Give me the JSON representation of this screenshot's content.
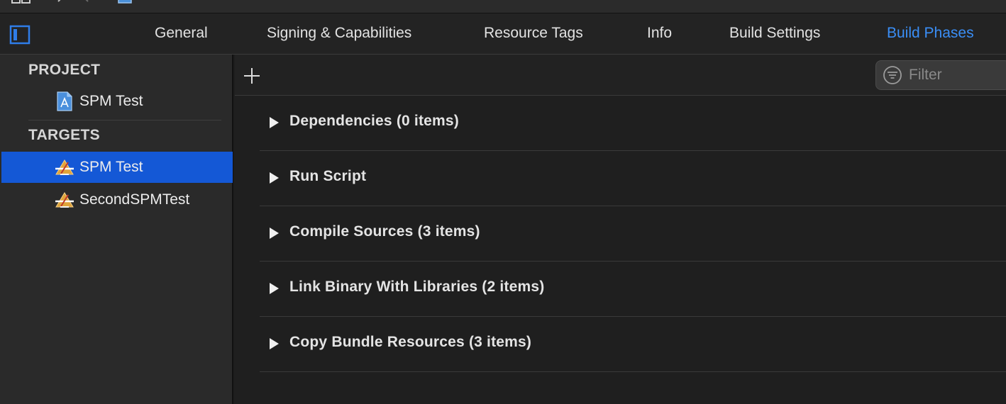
{
  "tabs": [
    {
      "label": "General",
      "active": false
    },
    {
      "label": "Signing & Capabilities",
      "active": false
    },
    {
      "label": "Resource Tags",
      "active": false
    },
    {
      "label": "Info",
      "active": false
    },
    {
      "label": "Build Settings",
      "active": false
    },
    {
      "label": "Build Phases",
      "active": true
    }
  ],
  "sidebar": {
    "project_header": "PROJECT",
    "project_items": [
      {
        "label": "SPM Test",
        "icon": "project-file-icon"
      }
    ],
    "targets_header": "TARGETS",
    "target_items": [
      {
        "label": "SPM Test",
        "icon": "app-target-icon",
        "selected": true
      },
      {
        "label": "SecondSPMTest",
        "icon": "app-target-icon",
        "selected": false
      }
    ]
  },
  "main": {
    "add_button_icon": "plus-icon",
    "filter": {
      "placeholder": "Filter",
      "value": "",
      "icon": "filter-icon"
    },
    "phases": [
      {
        "label": "Dependencies (0 items)"
      },
      {
        "label": "Run Script"
      },
      {
        "label": "Compile Sources (3 items)"
      },
      {
        "label": "Link Binary With Libraries (2 items)"
      },
      {
        "label": "Copy Bundle Resources (3 items)"
      }
    ]
  },
  "colors": {
    "accent": "#3a8ef6",
    "selection": "#1458d6",
    "background": "#1f1f1f",
    "sidebar": "#2a2a2a"
  }
}
